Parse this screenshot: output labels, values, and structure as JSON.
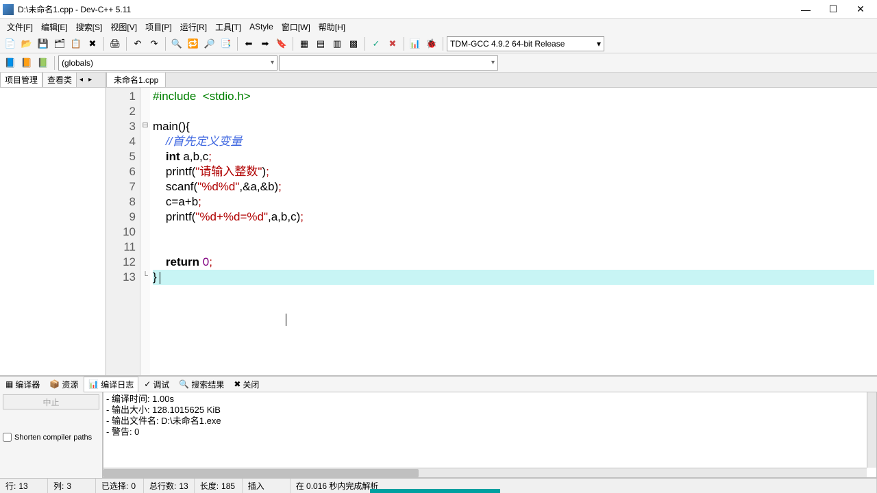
{
  "window": {
    "title": "D:\\未命名1.cpp - Dev-C++ 5.11"
  },
  "menus": [
    "文件[F]",
    "编辑[E]",
    "搜索[S]",
    "视图[V]",
    "项目[P]",
    "运行[R]",
    "工具[T]",
    "AStyle",
    "窗口[W]",
    "帮助[H]"
  ],
  "compiler_combo": "TDM-GCC 4.9.2 64-bit Release",
  "globals_combo": "(globals)",
  "sidebar": {
    "tabs": [
      "项目管理",
      "查看类"
    ]
  },
  "editor": {
    "tab": "未命名1.cpp",
    "lines": [
      {
        "n": "1",
        "seg": [
          {
            "c": "tok-pre",
            "t": "#include"
          },
          {
            "c": "",
            "t": "  "
          },
          {
            "c": "tok-pre",
            "t": "<stdio.h>"
          }
        ]
      },
      {
        "n": "2",
        "seg": []
      },
      {
        "n": "3",
        "fold": "⊟",
        "seg": [
          {
            "c": "",
            "t": "main(){"
          }
        ]
      },
      {
        "n": "4",
        "seg": [
          {
            "c": "",
            "t": "    "
          },
          {
            "c": "tok-cmt",
            "t": "//首先定义变量"
          }
        ]
      },
      {
        "n": "5",
        "seg": [
          {
            "c": "",
            "t": "    "
          },
          {
            "c": "tok-kw",
            "t": "int"
          },
          {
            "c": "",
            "t": " a,b,c"
          },
          {
            "c": "tok-punct",
            "t": ";"
          }
        ]
      },
      {
        "n": "6",
        "seg": [
          {
            "c": "",
            "t": "    printf("
          },
          {
            "c": "tok-str",
            "t": "\"请输入整数\""
          },
          {
            "c": "",
            "t": ")"
          },
          {
            "c": "tok-punct",
            "t": ";"
          }
        ]
      },
      {
        "n": "7",
        "seg": [
          {
            "c": "",
            "t": "    scanf("
          },
          {
            "c": "tok-str",
            "t": "\"%d%d\""
          },
          {
            "c": "",
            "t": ",&a,&b)"
          },
          {
            "c": "tok-punct",
            "t": ";"
          }
        ]
      },
      {
        "n": "8",
        "seg": [
          {
            "c": "",
            "t": "    c=a+b"
          },
          {
            "c": "tok-punct",
            "t": ";"
          }
        ]
      },
      {
        "n": "9",
        "seg": [
          {
            "c": "",
            "t": "    printf("
          },
          {
            "c": "tok-str",
            "t": "\"%d+%d=%d\""
          },
          {
            "c": "",
            "t": ",a,b,c)"
          },
          {
            "c": "tok-punct",
            "t": ";"
          }
        ]
      },
      {
        "n": "10",
        "seg": []
      },
      {
        "n": "11",
        "seg": []
      },
      {
        "n": "12",
        "seg": [
          {
            "c": "",
            "t": "    "
          },
          {
            "c": "tok-kw",
            "t": "return"
          },
          {
            "c": "",
            "t": " "
          },
          {
            "c": "tok-num",
            "t": "0"
          },
          {
            "c": "tok-punct",
            "t": ";"
          }
        ]
      },
      {
        "n": "13",
        "fold": "└",
        "current": true,
        "seg": [
          {
            "c": "",
            "t": "} "
          }
        ],
        "cursor": true
      }
    ]
  },
  "bottom": {
    "tabs": [
      "编译器",
      "资源",
      "编译日志",
      "调试",
      "搜索结果",
      "关闭"
    ],
    "active_tab": 2,
    "abort_btn": "中止",
    "shorten_label": "Shorten compiler paths",
    "output": [
      "- 警告: 0",
      "- 输出文件名: D:\\未命名1.exe",
      "- 输出大小: 128.1015625 KiB",
      "- 编译时间: 1.00s"
    ]
  },
  "status": {
    "line_lbl": "行:",
    "line": "13",
    "col_lbl": "列:",
    "col": "3",
    "sel_lbl": "已选择:",
    "sel": "0",
    "total_lbl": "总行数:",
    "total": "13",
    "len_lbl": "长度:",
    "len": "185",
    "ins": "插入",
    "parse": "在 0.016 秒内完成解析"
  },
  "icons": {
    "new": "📄",
    "open": "📂",
    "save": "💾",
    "saveall": "🗂",
    "print": "🖨",
    "undo": "↶",
    "redo": "↷",
    "find": "🔍",
    "replace": "🔁",
    "compile": "⚙",
    "run": "▶",
    "compilerun": "⚡",
    "rebuild": "🔨",
    "debug": "🐞",
    "profile": "📊",
    "min": "—",
    "max": "☐",
    "close": "✕"
  }
}
